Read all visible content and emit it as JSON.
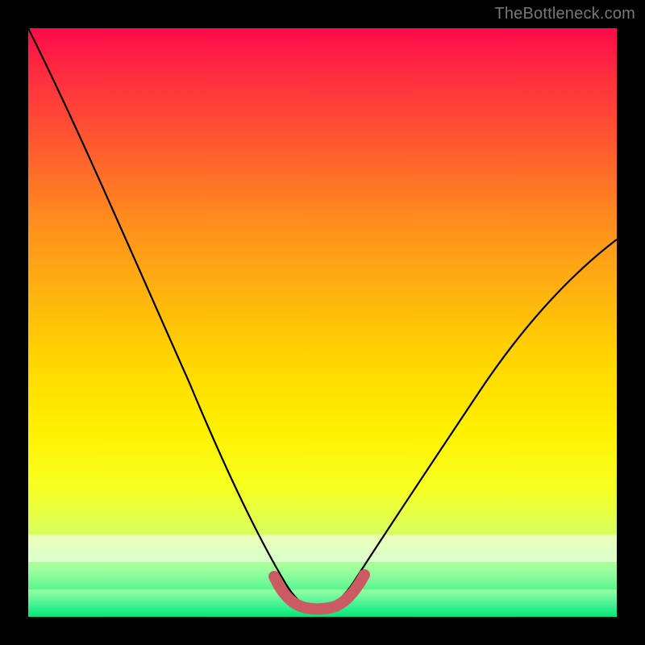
{
  "watermark": "TheBottleneck.com",
  "chart_data": {
    "type": "line",
    "title": "",
    "xlabel": "",
    "ylabel": "",
    "xlim": [
      0,
      100
    ],
    "ylim": [
      0,
      100
    ],
    "series": [
      {
        "name": "bottleneck-curve",
        "x": [
          0,
          6,
          12,
          18,
          24,
          30,
          36,
          40,
          43,
          46,
          49,
          52,
          55,
          60,
          66,
          74,
          84,
          94,
          100
        ],
        "values": [
          100,
          88,
          76,
          64,
          52,
          40,
          28,
          18,
          10,
          4,
          2,
          2,
          4,
          10,
          20,
          32,
          45,
          56,
          62
        ]
      },
      {
        "name": "highlighted-minimum-band",
        "x": [
          42,
          45,
          48,
          51,
          54,
          57
        ],
        "values": [
          5,
          2,
          1,
          1,
          2,
          5
        ]
      }
    ],
    "annotations": [],
    "grid": false,
    "legend": false
  }
}
